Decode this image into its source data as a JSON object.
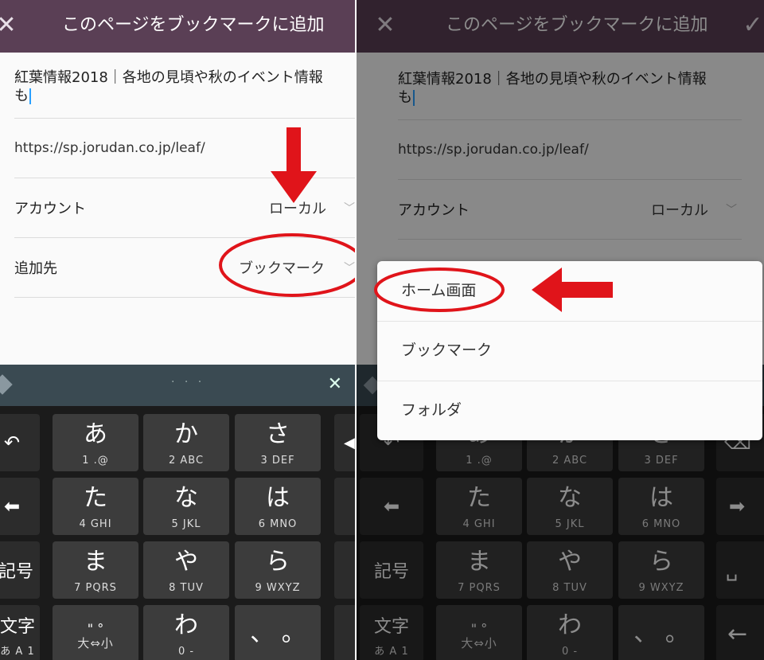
{
  "left": {
    "header_title": "このページをブックマークに追加",
    "page_title_line1": "紅葉情報2018｜各地の見頃や秋のイベント情報",
    "page_title_line2": "も",
    "url": "https://sp.jorudan.co.jp/leaf/",
    "account_label": "アカウント",
    "account_value": "ローカル",
    "dest_label": "追加先",
    "dest_value": "ブックマーク"
  },
  "right": {
    "header_title": "このページをブックマークに追加",
    "page_title_line1": "紅葉情報2018｜各地の見頃や秋のイベント情報",
    "page_title_line2": "も",
    "url": "https://sp.jorudan.co.jp/leaf/",
    "account_label": "アカウント",
    "account_value": "ローカル",
    "popup_items": [
      "ホーム画面",
      "ブックマーク",
      "フォルダ"
    ]
  },
  "keyboard": {
    "rows": [
      [
        {
          "big": "あ",
          "small": "1  .@"
        },
        {
          "big": "か",
          "small": "2  ABC"
        },
        {
          "big": "さ",
          "small": "3  DEF"
        }
      ],
      [
        {
          "big": "た",
          "small": "4  GHI"
        },
        {
          "big": "な",
          "small": "5  JKL"
        },
        {
          "big": "は",
          "small": "6  MNO"
        }
      ],
      [
        {
          "big": "ま",
          "small": "7 PQRS"
        },
        {
          "big": "や",
          "small": "8  TUV"
        },
        {
          "big": "ら",
          "small": "9 WXYZ"
        }
      ],
      [
        {
          "big": "\"  °",
          "small": "大⇔小"
        },
        {
          "big": "わ",
          "small": "0   -"
        },
        {
          "big": "、 。",
          "small": ""
        }
      ]
    ],
    "side_left": [
      "↶",
      "⬅",
      "記号",
      "文字"
    ],
    "side_left_sub": "あ A 1",
    "side_right_right": [
      "⌫",
      "➡",
      "␣",
      "←"
    ]
  },
  "icons": {
    "close": "close-icon",
    "check": "check-icon",
    "chevron": "chevron-down-icon"
  },
  "colors": {
    "header": "#5a3f55",
    "annotation": "#e0141a",
    "keyboard_bar": "#3a4a52"
  }
}
